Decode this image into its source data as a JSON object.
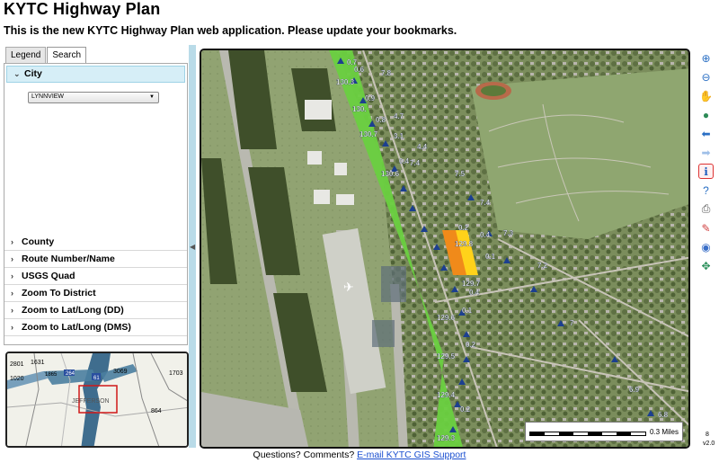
{
  "header": {
    "title": "KYTC Highway Plan",
    "notice": "This is the new KYTC Highway Plan web application. Please update your bookmarks."
  },
  "tabs": [
    {
      "label": "Legend",
      "active": false
    },
    {
      "label": "Search",
      "active": true
    }
  ],
  "search": {
    "city": {
      "label": "City",
      "selected": "LYNNVIEW"
    },
    "sections": [
      {
        "label": "County"
      },
      {
        "label": "Route Number/Name"
      },
      {
        "label": "USGS Quad"
      },
      {
        "label": "Zoom To District"
      },
      {
        "label": "Zoom to Lat/Long (DD)"
      },
      {
        "label": "Zoom to Lat/Long (DMS)"
      }
    ]
  },
  "overview": {
    "labels": [
      "1631",
      "2801",
      "1020",
      "1865",
      "264",
      "3069",
      "1703",
      "JEFFERSON",
      "864",
      "61"
    ]
  },
  "map": {
    "mile_labels": [
      "0.7",
      "0.6",
      "7.8",
      "130.3",
      "0.9",
      "130.",
      "0.8",
      "4.7",
      "130.7",
      "3.1",
      "4.4",
      "7.4",
      "0.4",
      "7.5",
      "130.6",
      "7.4",
      "0.2",
      "0.4",
      "7.3",
      "129.8",
      "0.1",
      "7.2",
      "129.7",
      "0.4",
      "0.1",
      "7",
      "129.6",
      "0.2",
      "129.5",
      "129.4",
      "0.2",
      "129.3",
      "6.9",
      "6.8"
    ],
    "scale_label": "0.3 Miles"
  },
  "toolbar": {
    "tools": [
      {
        "icon": "zoom-in-icon",
        "glyph": "⊕",
        "color": "#2a6fc4"
      },
      {
        "icon": "zoom-out-icon",
        "glyph": "⊖",
        "color": "#2a6fc4"
      },
      {
        "icon": "pan-hand-icon",
        "glyph": "✋",
        "color": "#e0a020"
      },
      {
        "icon": "full-extent-globe-icon",
        "glyph": "●",
        "color": "#2e8b57"
      },
      {
        "icon": "previous-extent-icon",
        "glyph": "⬅",
        "color": "#2a6fc4"
      },
      {
        "icon": "next-extent-icon",
        "glyph": "➡",
        "color": "#9fbfe8"
      },
      {
        "icon": "identify-info-icon",
        "glyph": "ℹ",
        "color": "#1f5fbf",
        "active": true
      },
      {
        "icon": "query-help-icon",
        "glyph": "?",
        "color": "#2a6fc4"
      },
      {
        "icon": "print-icon",
        "glyph": "⎙",
        "color": "#555555"
      },
      {
        "icon": "eraser-icon",
        "glyph": "✎",
        "color": "#d04040"
      },
      {
        "icon": "basemap-globe-icon",
        "glyph": "◉",
        "color": "#3a6fc8"
      },
      {
        "icon": "coordinates-icon",
        "glyph": "✥",
        "color": "#2a8f5a"
      }
    ]
  },
  "zoom_level": "8",
  "version": "v2.0",
  "footer": {
    "text": "Questions? Comments?",
    "link": "E-mail KYTC GIS Support"
  }
}
